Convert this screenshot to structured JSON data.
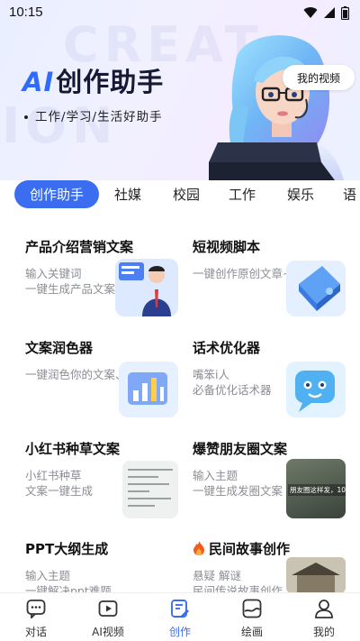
{
  "status_bar": {
    "time": "10:15"
  },
  "header": {
    "title_ai": "AI",
    "title_rest": "创作助手",
    "subtitle": "工作/学习/生活好助手",
    "watermark_1": "CREAT",
    "watermark_2": "ION",
    "video_button": "我的视频"
  },
  "tabs": [
    {
      "label": "创作助手",
      "active": true
    },
    {
      "label": "社媒"
    },
    {
      "label": "校园"
    },
    {
      "label": "工作"
    },
    {
      "label": "娱乐"
    },
    {
      "label": "语"
    }
  ],
  "cards": [
    {
      "title": "产品介绍营销文案",
      "desc_1": "输入关键词",
      "desc_2": "一键生成产品文案",
      "thumb": "businessman-presentation"
    },
    {
      "title": "短视频脚本",
      "desc_1": "一键创作原创文章~",
      "desc_2": "",
      "thumb": "blue-3d-shape"
    },
    {
      "title": "文案润色器",
      "desc_1": "一键润色你的文案、文章",
      "desc_2": "",
      "thumb": "chart-board"
    },
    {
      "title": "话术优化器",
      "desc_1": "嘴笨i人",
      "desc_2": "必备优化话术器",
      "thumb": "smiling-chat-bot"
    },
    {
      "title": "小红书种草文案",
      "desc_1": "小红书种草",
      "desc_2": "文案一键生成",
      "thumb": "note-document"
    },
    {
      "title": "爆赞朋友圈文案",
      "desc_1": "输入主题",
      "desc_2": "一键生成发圈文案",
      "thumb": "moments-post",
      "thumb_text": "朋友圈这样发，100"
    },
    {
      "title": "PPT大纲生成",
      "desc_1": "输入主题",
      "desc_2": "一键解决ppt难题",
      "thumb": ""
    },
    {
      "title": "民间故事创作",
      "desc_1": "悬疑 解谜",
      "desc_2": "民间传说故事创作",
      "thumb": "ancient-house",
      "title_icon": "fire-icon"
    }
  ],
  "bottom_nav": [
    {
      "label": "对话",
      "icon": "chat-icon"
    },
    {
      "label": "AI视频",
      "icon": "video-icon"
    },
    {
      "label": "创作",
      "icon": "edit-icon",
      "active": true
    },
    {
      "label": "绘画",
      "icon": "paint-icon"
    },
    {
      "label": "我的",
      "icon": "person-icon"
    }
  ],
  "colors": {
    "accent": "#3a6df0",
    "ai_blue": "#2f6bff",
    "desc_gray": "#8a8d94"
  }
}
